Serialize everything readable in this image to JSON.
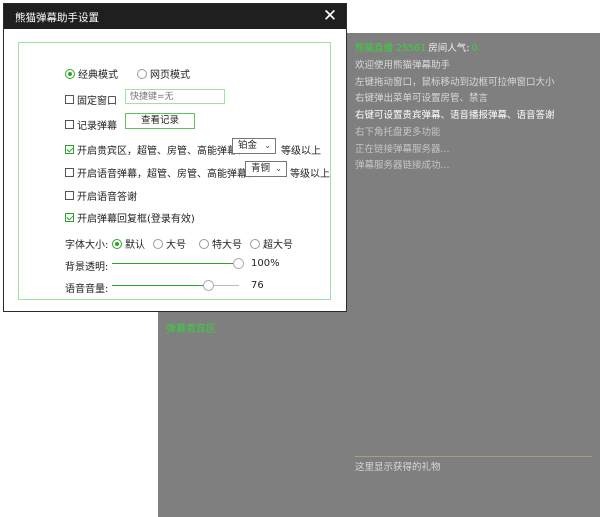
{
  "right_panel": {
    "room_name": "熊猫直播 25561",
    "popularity_label": "房间人气:",
    "popularity_value": "0",
    "messages": [
      "欢迎使用熊猫弹幕助手",
      "左键拖动窗口，鼠标移动到边框可拉伸窗口大小",
      "右键弹出菜单可设置房管、禁言",
      "右键可设置贵宾弹幕、语音播报弹幕、语音答谢",
      "右下角托盘更多功能",
      "正在链接弹幕服务器...",
      "弹幕服务器链接成功..."
    ],
    "gift_hint": "这里显示获得的礼物"
  },
  "bottom_panel": {
    "vip_area_label": "弹幕贵宾区"
  },
  "dialog": {
    "title": "熊猫弹幕助手设置",
    "close_label": "✕",
    "mode": {
      "classic_label": "经典模式",
      "web_label": "网页模式",
      "selected": "classic"
    },
    "fix_window": {
      "label": "固定窗口",
      "checked": false,
      "hotkey_placeholder": "快捷键=无"
    },
    "record": {
      "label": "记录弹幕",
      "checked": false,
      "view_button": "查看记录"
    },
    "vip_zone": {
      "label": "开启贵宾区，超管、房管、高能弹幕、",
      "checked": true,
      "level": "铂金",
      "suffix": "等级以上"
    },
    "voice_danmu": {
      "label": "开启语音弹幕，超管、房管、高能弹幕、",
      "checked": false,
      "level": "青铜",
      "suffix": "等级以上"
    },
    "voice_thanks": {
      "label": "开启语音答谢",
      "checked": false
    },
    "reply_box": {
      "label": "开启弹幕回复框(登录有效)",
      "checked": true
    },
    "font_size": {
      "label": "字体大小:",
      "options": [
        "默认",
        "大号",
        "特大号",
        "超大号"
      ],
      "selected": "默认"
    },
    "bg_opacity": {
      "label": "背景透明:",
      "value": "100%",
      "fraction": 1.0
    },
    "voice_volume": {
      "label": "语音音量:",
      "value": "76",
      "fraction": 0.76
    }
  },
  "colors": {
    "accent_green": "#2aa52a",
    "danmu_green": "#3bd13b",
    "panel_gray": "#7f7f7f",
    "titlebar": "#1f1f1f"
  }
}
